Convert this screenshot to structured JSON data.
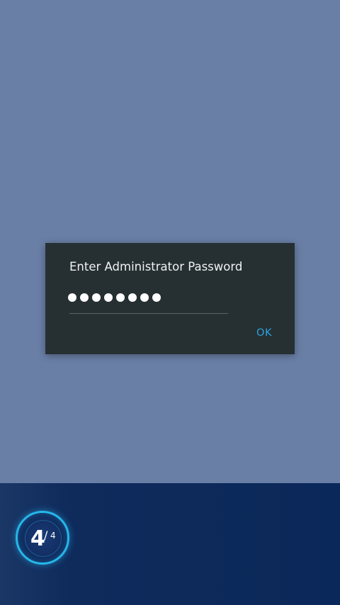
{
  "dialog": {
    "title": "Enter Administrator Password",
    "password_value": "••••••••",
    "password_length": 8,
    "ok_label": "OK"
  },
  "progress": {
    "current": "4",
    "separator": "/",
    "total": "4"
  },
  "colors": {
    "background": "#6a7fa6",
    "bottom_bar": "#0b285a",
    "dialog": "#263033",
    "accent": "#2aa3e0",
    "badge_ring": "#27b6ea"
  }
}
